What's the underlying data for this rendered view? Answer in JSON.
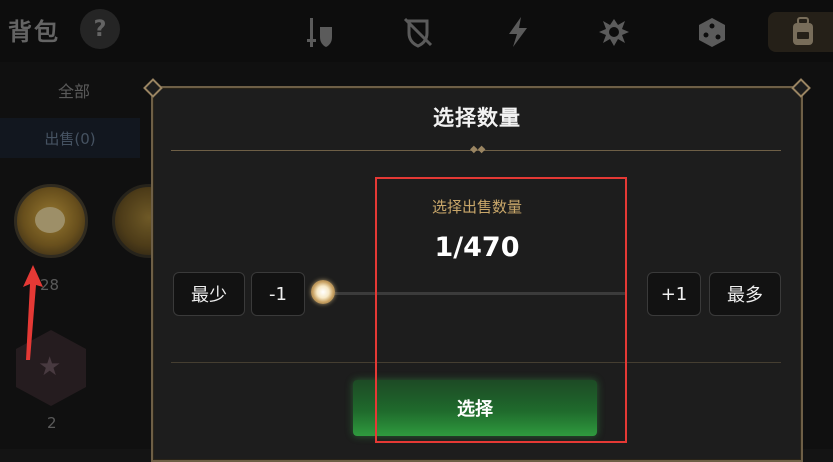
{
  "background": {
    "title": "背包",
    "help_label": "?",
    "tab_all": "全部",
    "tab_sell": "出售(0)",
    "item_counts": [
      "28",
      "2"
    ],
    "top_icons": [
      "sword-shield-icon",
      "crossed-shield-icon",
      "lightning-icon",
      "creature-icon",
      "dice-icon",
      "backpack-icon"
    ]
  },
  "dialog": {
    "title": "选择数量",
    "subtitle": "选择出售数量",
    "quantity": "1/470",
    "slider_fraction": 0.0021,
    "buttons": {
      "min": "最少",
      "minus": "-1",
      "plus": "+1",
      "max": "最多",
      "select": "选择"
    }
  },
  "annotation": {
    "highlight_color": "#e53935",
    "arrow_color": "#e53935"
  }
}
